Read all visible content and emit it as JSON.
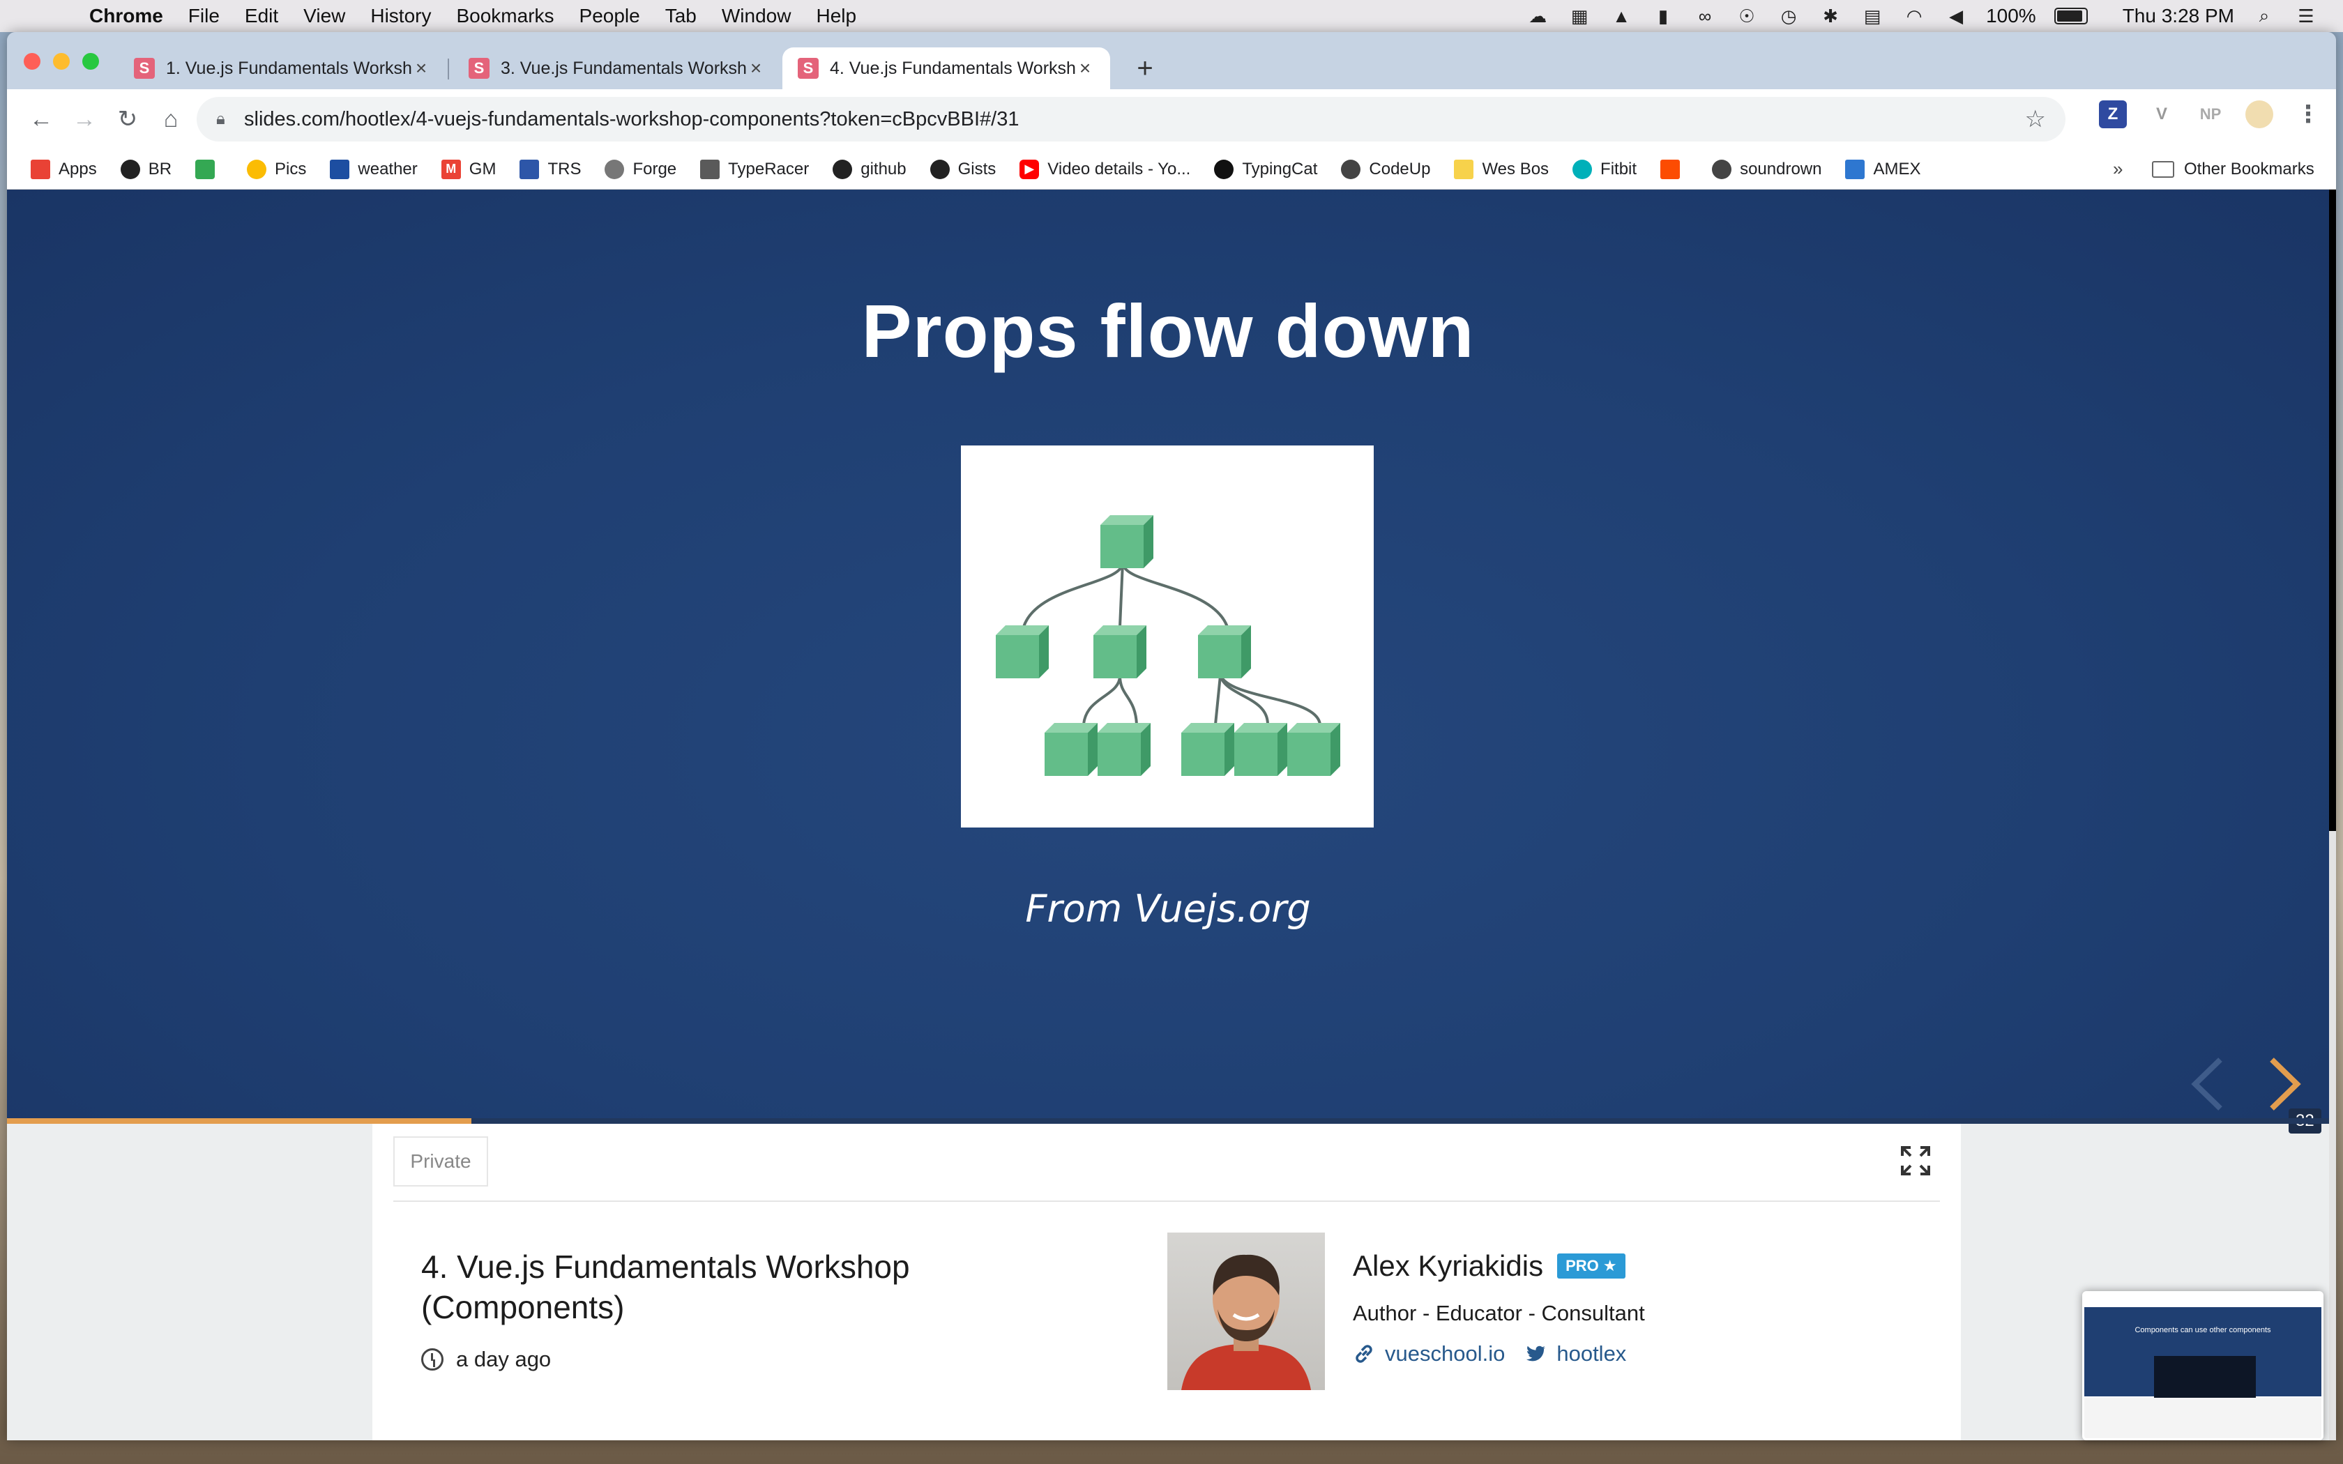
{
  "menubar": {
    "app": "Chrome",
    "items": [
      "File",
      "Edit",
      "View",
      "History",
      "Bookmarks",
      "People",
      "Tab",
      "Window",
      "Help"
    ],
    "battery": "100%",
    "clock": "Thu 3:28 PM"
  },
  "tabs": [
    {
      "label": "1. Vue.js Fundamentals Worksh",
      "favicon": "S"
    },
    {
      "label": "3. Vue.js Fundamentals Worksh",
      "favicon": "S"
    },
    {
      "label": "4. Vue.js Fundamentals Worksh",
      "favicon": "S",
      "active": true
    }
  ],
  "omnibox": {
    "url": "slides.com/hootlex/4-vuejs-fundamentals-workshop-components?token=cBpcvBBI#/31"
  },
  "extensions": [
    "Z",
    "V",
    "NP"
  ],
  "bookmarks": [
    "Apps",
    "BR",
    "",
    "Pics",
    "weather",
    "GM",
    "TRS",
    "Forge",
    "TypeRacer",
    "github",
    "Gists",
    "Video details - Yo...",
    "TypingCat",
    "CodeUp",
    "Wes Bos",
    "Fitbit",
    "",
    "soundrown",
    "AMEX"
  ],
  "bookmarks_more": "»",
  "bookmarks_other": "Other Bookmarks",
  "slide": {
    "title": "Props flow down",
    "caption": "From Vuejs.org",
    "number": "32",
    "progress_fraction": 0.2
  },
  "info": {
    "visibility": "Private",
    "deck_title": "4. Vue.js Fundamentals Workshop (Components)",
    "time": "a day ago",
    "author": "Alex Kyriakidis",
    "pro_badge": "PRO ★",
    "role": "Author - Educator - Consultant",
    "website": "vueschool.io",
    "twitter": "hootlex"
  },
  "thumbnail": {
    "title": "Components can use other components"
  },
  "colors": {
    "slide_bg": "#1f3f72",
    "accent": "#e39d4e",
    "cube": "#63bd89",
    "link": "#27598c",
    "pro": "#2b9ad6"
  }
}
